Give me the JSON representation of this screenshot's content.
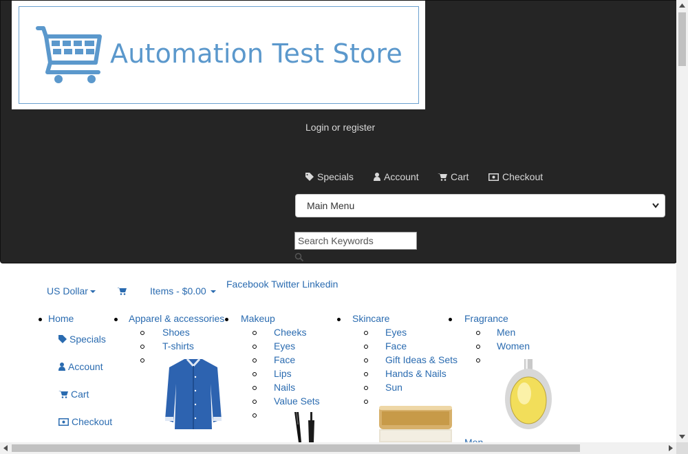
{
  "header": {
    "logo_text": "Automation Test Store",
    "login_label": "Login or register",
    "nav": [
      {
        "label": "Specials",
        "icon": "tag-icon"
      },
      {
        "label": "Account",
        "icon": "user-icon"
      },
      {
        "label": "Cart",
        "icon": "cart-icon"
      },
      {
        "label": "Checkout",
        "icon": "money-icon"
      }
    ],
    "main_menu_selected": "Main Menu",
    "search_placeholder": "Search Keywords"
  },
  "toolbar": {
    "currency": "US Dollar",
    "cart_items": "Items - $0.00",
    "social": "Facebook Twitter Linkedin"
  },
  "categories": {
    "home": "Home",
    "home_links": [
      "Specials",
      "Account",
      "Cart",
      "Checkout"
    ],
    "apparel": {
      "label": "Apparel & accessories",
      "items": [
        "Shoes",
        "T-shirts"
      ]
    },
    "makeup": {
      "label": "Makeup",
      "items": [
        "Cheeks",
        "Eyes",
        "Face",
        "Lips",
        "Nails",
        "Value Sets"
      ]
    },
    "skincare": {
      "label": "Skincare",
      "items": [
        "Eyes",
        "Face",
        "Gift Ideas & Sets",
        "Hands & Nails",
        "Sun"
      ]
    },
    "fragrance": {
      "label": "Fragrance",
      "items": [
        "Men",
        "Women"
      ],
      "partial": "Men"
    }
  },
  "colors": {
    "header_bg": "#252525",
    "link": "#2a6bb0",
    "logo_blue": "#5b98cc"
  }
}
